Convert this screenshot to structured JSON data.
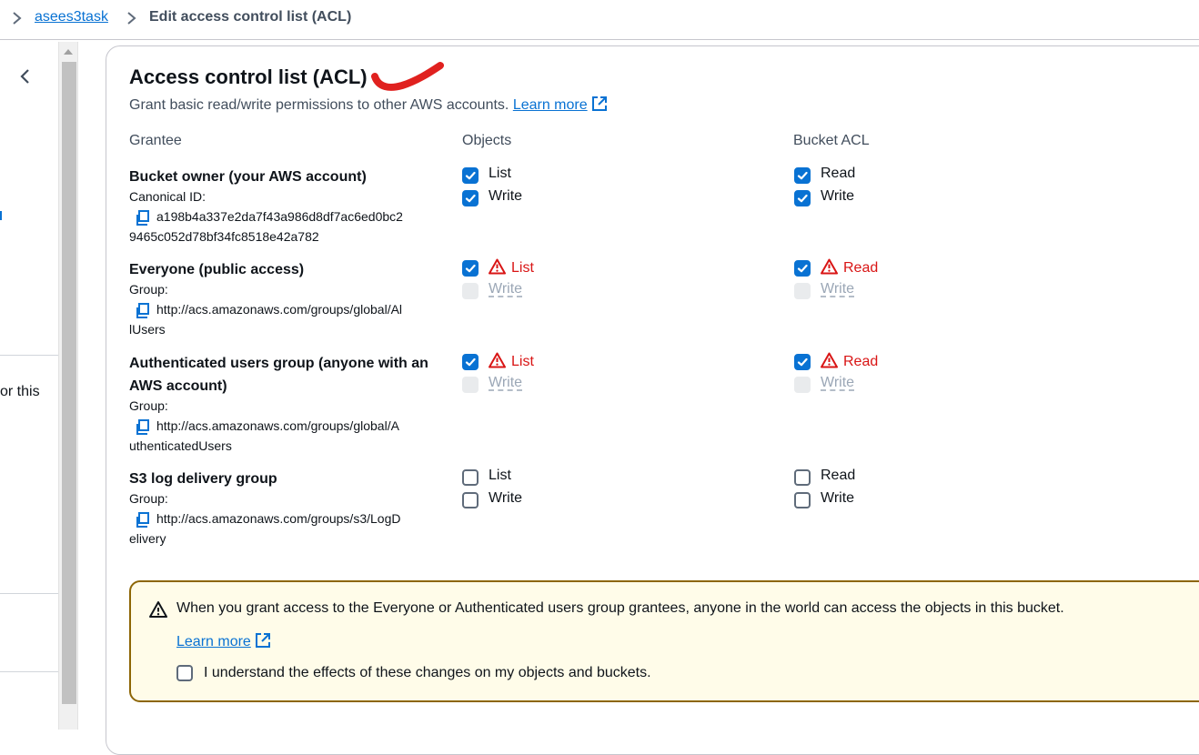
{
  "breadcrumb": {
    "bucket": "asees3task",
    "current": "Edit access control list (ACL)"
  },
  "sidebar": {
    "partial_text": "or this"
  },
  "acl": {
    "title": "Access control list (ACL)",
    "description": "Grant basic read/write permissions to other AWS accounts.",
    "learn_more": "Learn more",
    "columns": {
      "grantee": "Grantee",
      "objects": "Objects",
      "bucket_acl": "Bucket ACL"
    },
    "grantees": [
      {
        "name": "Bucket owner (your AWS account)",
        "sub_label": "Canonical ID:",
        "id_line1": "a198b4a337e2da7f43a986d8df7ac6ed0bc2",
        "id_line2": "9465c052d78bf34fc8518e42a782",
        "objects": [
          {
            "label": "List",
            "checked": true
          },
          {
            "label": "Write",
            "checked": true
          }
        ],
        "bucket_acl": [
          {
            "label": "Read",
            "checked": true
          },
          {
            "label": "Write",
            "checked": true
          }
        ]
      },
      {
        "name": "Everyone (public access)",
        "sub_label": "Group:",
        "id_line1": "http://acs.amazonaws.com/groups/global/Al",
        "id_line2": "lUsers",
        "objects": [
          {
            "label": "List",
            "checked": true,
            "warning": true
          },
          {
            "label": "Write",
            "checked": false,
            "disabled": true
          }
        ],
        "bucket_acl": [
          {
            "label": "Read",
            "checked": true,
            "warning": true
          },
          {
            "label": "Write",
            "checked": false,
            "disabled": true
          }
        ]
      },
      {
        "name": "Authenticated users group (anyone with an AWS account)",
        "sub_label": "Group:",
        "id_line1": "http://acs.amazonaws.com/groups/global/A",
        "id_line2": "uthenticatedUsers",
        "objects": [
          {
            "label": "List",
            "checked": true,
            "warning": true
          },
          {
            "label": "Write",
            "checked": false,
            "disabled": true
          }
        ],
        "bucket_acl": [
          {
            "label": "Read",
            "checked": true,
            "warning": true
          },
          {
            "label": "Write",
            "checked": false,
            "disabled": true
          }
        ]
      },
      {
        "name": "S3 log delivery group",
        "sub_label": "Group:",
        "id_line1": "http://acs.amazonaws.com/groups/s3/LogD",
        "id_line2": "elivery",
        "objects": [
          {
            "label": "List",
            "checked": false
          },
          {
            "label": "Write",
            "checked": false
          }
        ],
        "bucket_acl": [
          {
            "label": "Read",
            "checked": false
          },
          {
            "label": "Write",
            "checked": false
          }
        ]
      }
    ]
  },
  "alert": {
    "message": "When you grant access to the Everyone or Authenticated users group grantees, anyone in the world can access the objects in this bucket.",
    "learn_more": "Learn more",
    "acknowledge_label": "I understand the effects of these changes on my objects and buckets.",
    "acknowledge_checked": false
  },
  "colors": {
    "link": "#0972d3",
    "checkbox_checked": "#0972d3",
    "warning_text": "#d91515",
    "alert_border": "#8d6605",
    "alert_bg": "#fffce9",
    "annotation": "#e0211f"
  }
}
